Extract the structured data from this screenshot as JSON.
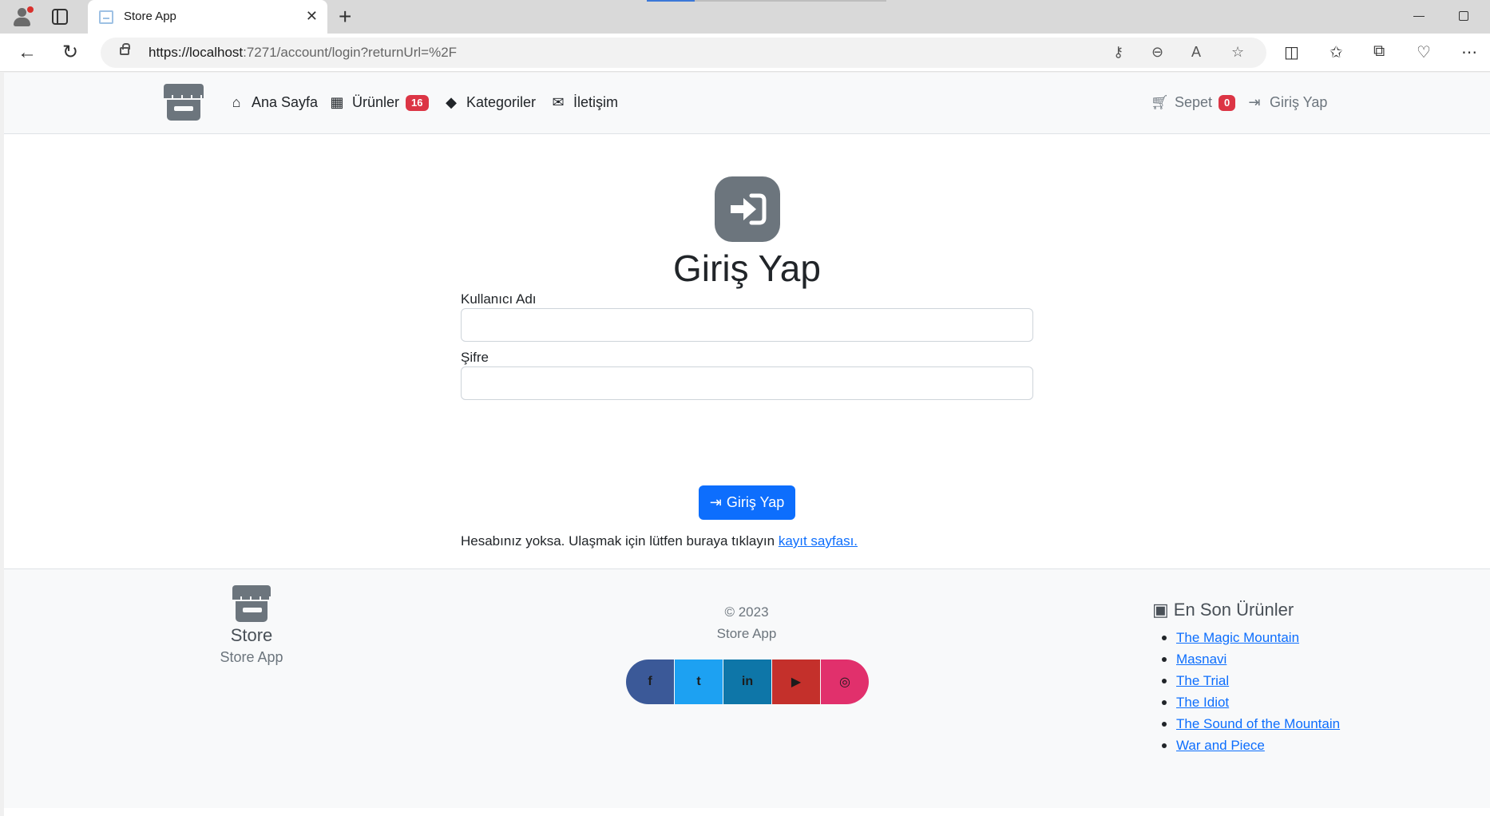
{
  "browser": {
    "tab_title": "Store App",
    "tab_close": "✕",
    "new_tab": "+",
    "url_host": "https://localhost",
    "url_path": ":7271/account/login?returnUrl=%2F"
  },
  "navbar": {
    "items": [
      {
        "label": "Ana Sayfa",
        "icon": "house-icon"
      },
      {
        "label": "Ürünler",
        "icon": "boxes-icon",
        "badge": "16"
      },
      {
        "label": "Kategoriler",
        "icon": "tags-icon"
      },
      {
        "label": "İletişim",
        "icon": "envelope-icon"
      }
    ],
    "cart": {
      "label": "Sepet",
      "badge": "0",
      "icon": "cart-icon"
    },
    "login": {
      "label": "Giriş Yap",
      "icon": "sign-in-icon"
    }
  },
  "login": {
    "title": "Giriş Yap",
    "username_label": "Kullanıcı Adı",
    "username_value": "",
    "password_label": "Şifre",
    "password_value": "",
    "submit_label": "Giriş Yap",
    "register_text": "Hesabınız yoksa. Ulaşmak için lütfen buraya tıklayın",
    "register_link": "kayıt sayfası."
  },
  "footer": {
    "brand_title": "Store",
    "brand_sub": "Store App",
    "copyright": "© 2023",
    "app_name": "Store App",
    "socials": [
      {
        "name": "facebook",
        "glyph": "f",
        "color": "#3b5998"
      },
      {
        "name": "twitter",
        "glyph": "t",
        "color": "#1da1f2"
      },
      {
        "name": "linkedin",
        "glyph": "in",
        "color": "#0e76a8"
      },
      {
        "name": "youtube",
        "glyph": "▶",
        "color": "#c4302b"
      },
      {
        "name": "instagram",
        "glyph": "◎",
        "color": "#e1306c"
      }
    ],
    "recent_title": "En Son Ürünler",
    "recent_products": [
      "The Magic Mountain",
      "Masnavi",
      "The Trial",
      "The Idiot",
      "The Sound of the Mountain",
      "War and Piece"
    ]
  },
  "colors": {
    "primary": "#0d6efd",
    "danger": "#dc3545",
    "secondary": "#6c757d",
    "light": "#f8f9fa"
  }
}
